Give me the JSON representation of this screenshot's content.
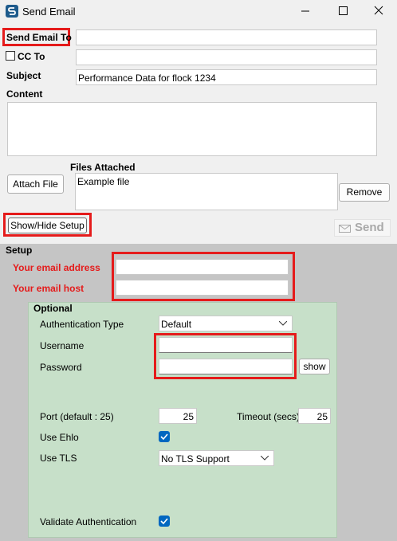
{
  "window": {
    "title": "Send Email"
  },
  "form": {
    "send_to_label": "Send Email To",
    "send_to_value": "",
    "cc_label": "CC To",
    "cc_value": "",
    "subject_label": "Subject",
    "subject_value": "Performance Data for flock 1234",
    "content_label": "Content",
    "content_value": "",
    "files_label": "Files Attached",
    "files": [
      "Example file"
    ],
    "attach_button": "Attach File",
    "remove_button": "Remove",
    "showhide_button": "Show/Hide Setup",
    "send_button": "Send"
  },
  "setup": {
    "label": "Setup",
    "email_address_label": "Your email address",
    "email_address_value": "",
    "email_host_label": "Your email host",
    "email_host_value": "",
    "optional_label": "Optional",
    "auth_type_label": "Authentication Type",
    "auth_type_value": "Default",
    "username_label": "Username",
    "username_value": "",
    "password_label": "Password",
    "password_value": "",
    "show_button": "show",
    "port_label": "Port (default : 25)",
    "port_value": "25",
    "timeout_label": "Timeout (secs)",
    "timeout_value": "25",
    "use_ehlo_label": "Use Ehlo",
    "use_ehlo_checked": true,
    "use_tls_label": "Use TLS",
    "use_tls_value": "No TLS Support",
    "validate_label": "Validate Authentication",
    "validate_checked": true
  },
  "colors": {
    "highlight": "#e51b1b",
    "optional_bg": "#c7e0c9",
    "setup_bg": "#c5c5c5",
    "accent": "#0067c0"
  }
}
